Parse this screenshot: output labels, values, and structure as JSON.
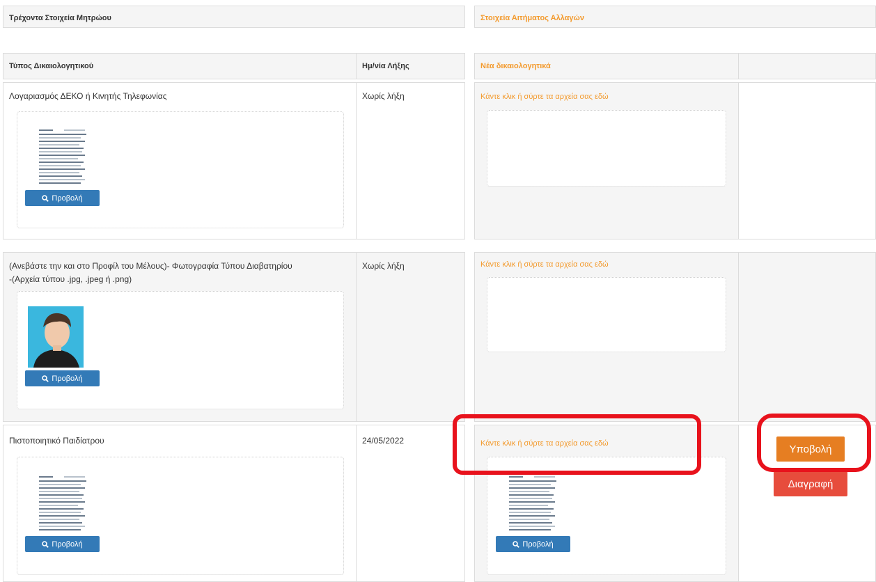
{
  "headers": {
    "current_record": "Τρέχοντα Στοιχεία Μητρώου",
    "change_request": "Στοιχεία Αιτήματος Αλλαγών",
    "doc_type": "Τύπος Δικαιολογητικού",
    "expiry": "Ημ/νία Λήξης",
    "new_docs": "Νέα δικαιολογητικά"
  },
  "rows": [
    {
      "doc_type": "Λογαριασμός ΔΕΚΟ ή Κινητής Τηλεφωνίας",
      "expiry": "Χωρίς λήξη",
      "dropzone": "Κάντε κλικ ή σύρτε τα αρχεία σας εδώ",
      "view_label": "Προβολή"
    },
    {
      "doc_type_line1": "(Ανεβάστε την και στο Προφίλ του Μέλους)- Φωτογραφία Τύπου Διαβατηρίου",
      "doc_type_line2": "-(Αρχεία τύπου .jpg, .jpeg ή .png)",
      "expiry": "Χωρίς λήξη",
      "dropzone": "Κάντε κλικ ή σύρτε τα αρχεία σας εδώ",
      "view_label": "Προβολή"
    },
    {
      "doc_type": "Πιστοποιητικό Παιδίατρου",
      "expiry": "24/05/2022",
      "dropzone": "Κάντε κλικ ή σύρτε τα αρχεία σας εδώ",
      "view_label": "Προβολή",
      "new_view_label": "Προβολή"
    }
  ],
  "actions": {
    "submit": "Υποβολή",
    "delete": "Διαγραφή"
  },
  "colors": {
    "accent_orange": "#f39a2d",
    "primary_blue": "#337ab7",
    "submit_orange": "#e67e22",
    "delete_red": "#e74c3c",
    "annotation_red": "#e8121c"
  },
  "icons": {
    "view": "search-icon"
  }
}
